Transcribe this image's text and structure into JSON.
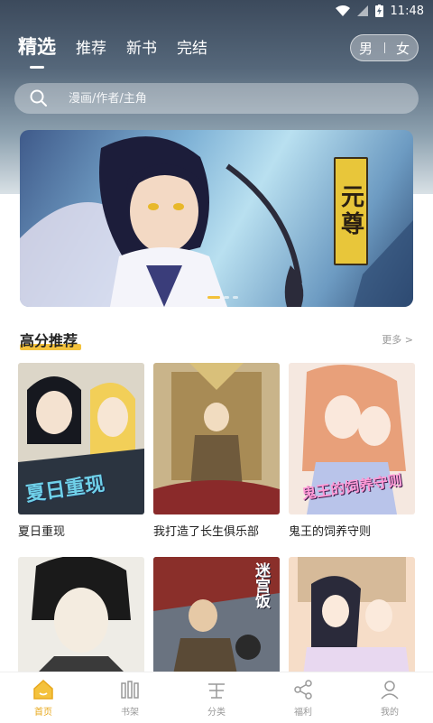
{
  "status_bar": {
    "time": "11:48"
  },
  "tabs": [
    {
      "label": "精选",
      "active": true
    },
    {
      "label": "推荐",
      "active": false
    },
    {
      "label": "新书",
      "active": false
    },
    {
      "label": "完结",
      "active": false
    }
  ],
  "gender": {
    "male": "男",
    "female": "女"
  },
  "search": {
    "placeholder": "漫画/作者/主角"
  },
  "banner": {
    "title": "元尊"
  },
  "section": {
    "title": "高分推荐",
    "more": "更多 >"
  },
  "cards": [
    {
      "title": "夏日重现",
      "cover_text": "夏日重现"
    },
    {
      "title": "我打造了长生俱乐部",
      "cover_text": ""
    },
    {
      "title": "鬼王的饲养守则",
      "cover_text": "鬼王的饲养守则"
    },
    {
      "title": "",
      "cover_text": ""
    },
    {
      "title": "",
      "cover_text": "迷宫饭"
    },
    {
      "title": "",
      "cover_text": ""
    }
  ],
  "bottom_nav": [
    {
      "label": "首页",
      "icon": "home-icon",
      "active": true
    },
    {
      "label": "书架",
      "icon": "bookshelf-icon",
      "active": false
    },
    {
      "label": "分类",
      "icon": "category-icon",
      "active": false
    },
    {
      "label": "福利",
      "icon": "share-icon",
      "active": false
    },
    {
      "label": "我的",
      "icon": "profile-icon",
      "active": false
    }
  ],
  "colors": {
    "accent": "#f4c23d",
    "nav_active": "#e8a81c"
  }
}
